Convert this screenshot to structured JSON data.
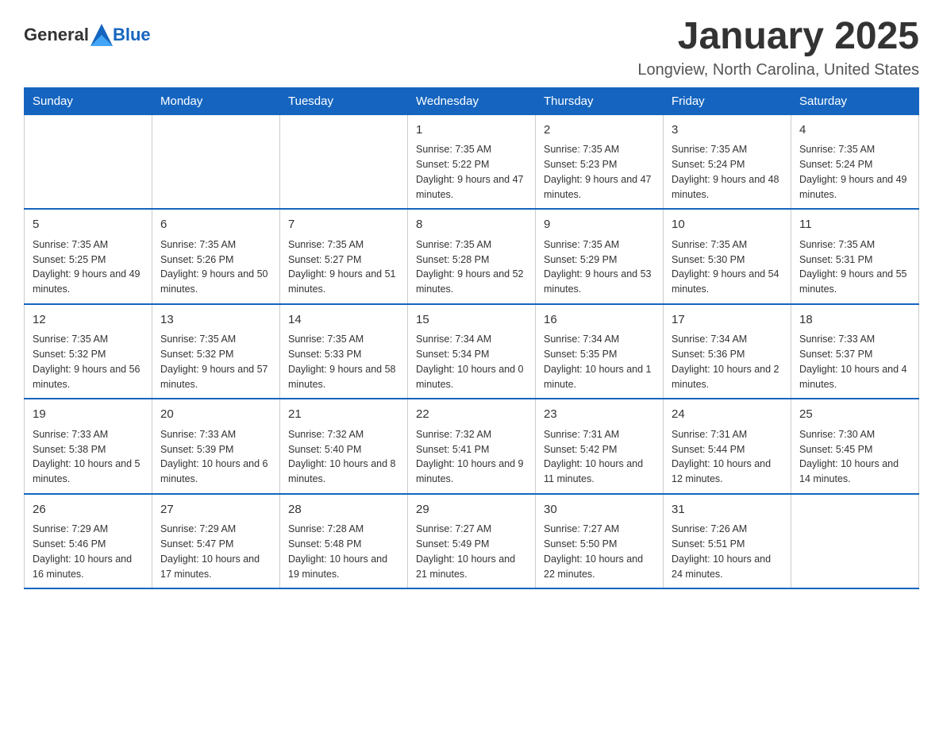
{
  "header": {
    "logo_general": "General",
    "logo_blue": "Blue",
    "month_title": "January 2025",
    "location": "Longview, North Carolina, United States"
  },
  "weekdays": [
    "Sunday",
    "Monday",
    "Tuesday",
    "Wednesday",
    "Thursday",
    "Friday",
    "Saturday"
  ],
  "weeks": [
    [
      {
        "day": "",
        "info": ""
      },
      {
        "day": "",
        "info": ""
      },
      {
        "day": "",
        "info": ""
      },
      {
        "day": "1",
        "info": "Sunrise: 7:35 AM\nSunset: 5:22 PM\nDaylight: 9 hours and 47 minutes."
      },
      {
        "day": "2",
        "info": "Sunrise: 7:35 AM\nSunset: 5:23 PM\nDaylight: 9 hours and 47 minutes."
      },
      {
        "day": "3",
        "info": "Sunrise: 7:35 AM\nSunset: 5:24 PM\nDaylight: 9 hours and 48 minutes."
      },
      {
        "day": "4",
        "info": "Sunrise: 7:35 AM\nSunset: 5:24 PM\nDaylight: 9 hours and 49 minutes."
      }
    ],
    [
      {
        "day": "5",
        "info": "Sunrise: 7:35 AM\nSunset: 5:25 PM\nDaylight: 9 hours and 49 minutes."
      },
      {
        "day": "6",
        "info": "Sunrise: 7:35 AM\nSunset: 5:26 PM\nDaylight: 9 hours and 50 minutes."
      },
      {
        "day": "7",
        "info": "Sunrise: 7:35 AM\nSunset: 5:27 PM\nDaylight: 9 hours and 51 minutes."
      },
      {
        "day": "8",
        "info": "Sunrise: 7:35 AM\nSunset: 5:28 PM\nDaylight: 9 hours and 52 minutes."
      },
      {
        "day": "9",
        "info": "Sunrise: 7:35 AM\nSunset: 5:29 PM\nDaylight: 9 hours and 53 minutes."
      },
      {
        "day": "10",
        "info": "Sunrise: 7:35 AM\nSunset: 5:30 PM\nDaylight: 9 hours and 54 minutes."
      },
      {
        "day": "11",
        "info": "Sunrise: 7:35 AM\nSunset: 5:31 PM\nDaylight: 9 hours and 55 minutes."
      }
    ],
    [
      {
        "day": "12",
        "info": "Sunrise: 7:35 AM\nSunset: 5:32 PM\nDaylight: 9 hours and 56 minutes."
      },
      {
        "day": "13",
        "info": "Sunrise: 7:35 AM\nSunset: 5:32 PM\nDaylight: 9 hours and 57 minutes."
      },
      {
        "day": "14",
        "info": "Sunrise: 7:35 AM\nSunset: 5:33 PM\nDaylight: 9 hours and 58 minutes."
      },
      {
        "day": "15",
        "info": "Sunrise: 7:34 AM\nSunset: 5:34 PM\nDaylight: 10 hours and 0 minutes."
      },
      {
        "day": "16",
        "info": "Sunrise: 7:34 AM\nSunset: 5:35 PM\nDaylight: 10 hours and 1 minute."
      },
      {
        "day": "17",
        "info": "Sunrise: 7:34 AM\nSunset: 5:36 PM\nDaylight: 10 hours and 2 minutes."
      },
      {
        "day": "18",
        "info": "Sunrise: 7:33 AM\nSunset: 5:37 PM\nDaylight: 10 hours and 4 minutes."
      }
    ],
    [
      {
        "day": "19",
        "info": "Sunrise: 7:33 AM\nSunset: 5:38 PM\nDaylight: 10 hours and 5 minutes."
      },
      {
        "day": "20",
        "info": "Sunrise: 7:33 AM\nSunset: 5:39 PM\nDaylight: 10 hours and 6 minutes."
      },
      {
        "day": "21",
        "info": "Sunrise: 7:32 AM\nSunset: 5:40 PM\nDaylight: 10 hours and 8 minutes."
      },
      {
        "day": "22",
        "info": "Sunrise: 7:32 AM\nSunset: 5:41 PM\nDaylight: 10 hours and 9 minutes."
      },
      {
        "day": "23",
        "info": "Sunrise: 7:31 AM\nSunset: 5:42 PM\nDaylight: 10 hours and 11 minutes."
      },
      {
        "day": "24",
        "info": "Sunrise: 7:31 AM\nSunset: 5:44 PM\nDaylight: 10 hours and 12 minutes."
      },
      {
        "day": "25",
        "info": "Sunrise: 7:30 AM\nSunset: 5:45 PM\nDaylight: 10 hours and 14 minutes."
      }
    ],
    [
      {
        "day": "26",
        "info": "Sunrise: 7:29 AM\nSunset: 5:46 PM\nDaylight: 10 hours and 16 minutes."
      },
      {
        "day": "27",
        "info": "Sunrise: 7:29 AM\nSunset: 5:47 PM\nDaylight: 10 hours and 17 minutes."
      },
      {
        "day": "28",
        "info": "Sunrise: 7:28 AM\nSunset: 5:48 PM\nDaylight: 10 hours and 19 minutes."
      },
      {
        "day": "29",
        "info": "Sunrise: 7:27 AM\nSunset: 5:49 PM\nDaylight: 10 hours and 21 minutes."
      },
      {
        "day": "30",
        "info": "Sunrise: 7:27 AM\nSunset: 5:50 PM\nDaylight: 10 hours and 22 minutes."
      },
      {
        "day": "31",
        "info": "Sunrise: 7:26 AM\nSunset: 5:51 PM\nDaylight: 10 hours and 24 minutes."
      },
      {
        "day": "",
        "info": ""
      }
    ]
  ]
}
